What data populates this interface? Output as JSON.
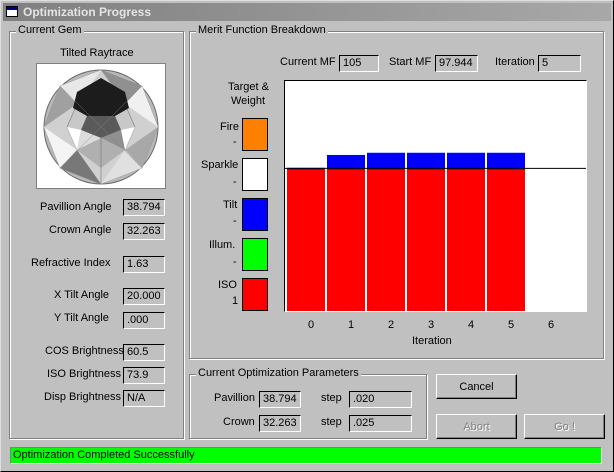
{
  "window": {
    "title": "Optimization Progress"
  },
  "current_gem": {
    "group_title": "Current Gem",
    "raytrace_label": "Tilted Raytrace",
    "fields": [
      {
        "label": "Pavillion Angle",
        "value": "38.794"
      },
      {
        "label": "Crown Angle",
        "value": "32.263"
      },
      {
        "label": "Refractive Index",
        "value": "1.63"
      },
      {
        "label": "X Tilt Angle",
        "value": "20.000"
      },
      {
        "label": "Y Tilt Angle",
        "value": ".000"
      },
      {
        "label": "COS Brightness",
        "value": "60.5"
      },
      {
        "label": "ISO Brightness",
        "value": "73.9"
      },
      {
        "label": "Disp Brightness",
        "value": "N/A"
      }
    ]
  },
  "merit": {
    "group_title": "Merit Function Breakdown",
    "current_mf_label": "Current MF",
    "current_mf": "105",
    "start_mf_label": "Start MF",
    "start_mf": "97.944",
    "iteration_label": "Iteration",
    "iteration": "5",
    "legend_title_1": "Target &",
    "legend_title_2": "Weight",
    "legend": [
      {
        "name": "Fire",
        "weight": "-",
        "color": "#ff8000"
      },
      {
        "name": "Sparkle",
        "weight": "-",
        "color": "#ffffff"
      },
      {
        "name": "Tilt",
        "weight": "-",
        "color": "#0000ff"
      },
      {
        "name": "Illum.",
        "weight": "-",
        "color": "#00ff00"
      },
      {
        "name": "ISO",
        "weight": "1",
        "color": "#ff0000"
      }
    ]
  },
  "chart_data": {
    "type": "bar",
    "stacked": true,
    "x": [
      0,
      1,
      2,
      3,
      4,
      5
    ],
    "x_ticks": [
      "0",
      "1",
      "2",
      "3",
      "4",
      "5",
      "6"
    ],
    "xlabel": "Iteration",
    "reference_line": 97.944,
    "series": [
      {
        "name": "ISO",
        "color": "#ff0000",
        "values": [
          97.2,
          97.2,
          97.2,
          97.2,
          97.2,
          97.2
        ]
      },
      {
        "name": "Tilt",
        "color": "#0000ff",
        "values": [
          1.2,
          10.0,
          11.5,
          11.5,
          11.5,
          11.5
        ]
      }
    ],
    "ylim": [
      0,
      158
    ]
  },
  "params": {
    "group_title": "Current Optimization Parameters",
    "pavillion_label": "Pavillion",
    "pavillion_value": "38.794",
    "pavillion_step_label": "step",
    "pavillion_step": ".020",
    "crown_label": "Crown",
    "crown_value": "32.263",
    "crown_step_label": "step",
    "crown_step": ".025"
  },
  "buttons": {
    "cancel": "Cancel",
    "abort": "Abort",
    "go": "Go !"
  },
  "status": {
    "text": "Optimization Completed Successfully"
  },
  "colors": {
    "status_bg": "#00ff00",
    "titlebar": "#808080"
  }
}
